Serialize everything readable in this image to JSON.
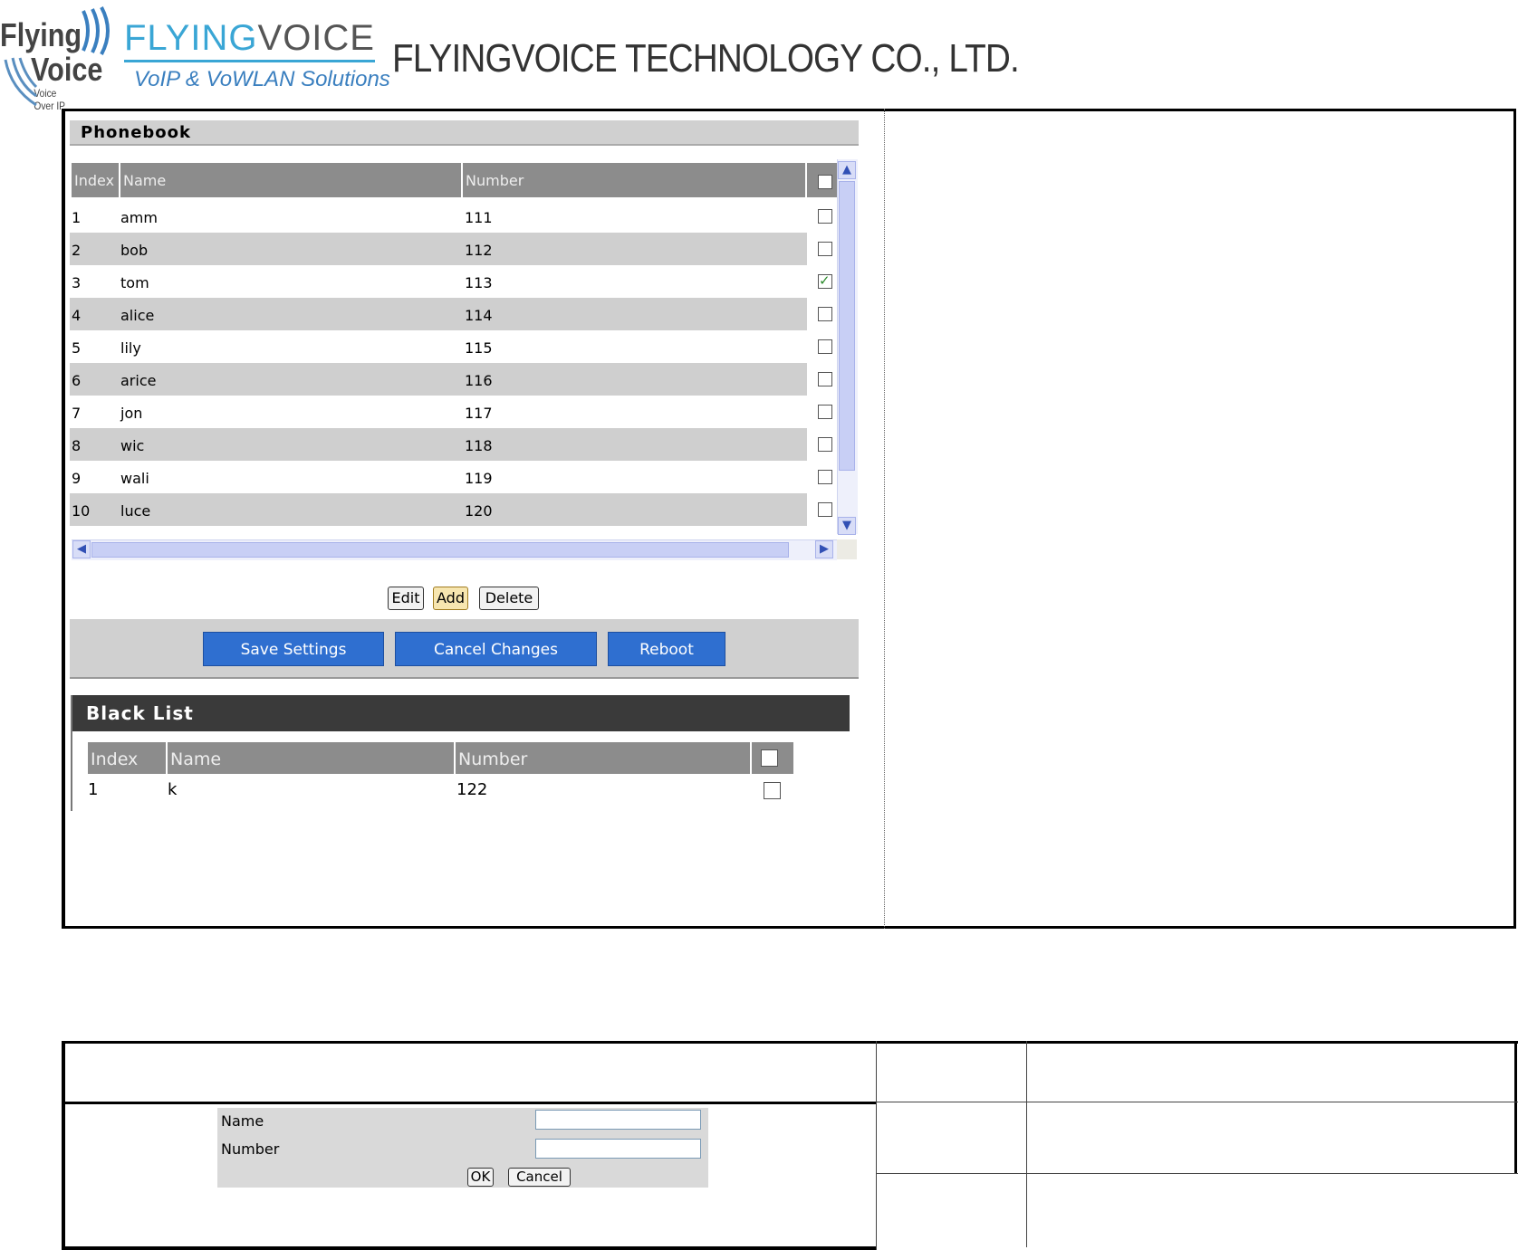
{
  "header": {
    "logo1_line1": "Flying",
    "logo1_line2": "Voice",
    "logo1_tagline": "Voice Over IP",
    "logo2_part1": "FLYING",
    "logo2_part2": "VOICE",
    "logo2_tagline": "VoIP & VoWLAN Solutions",
    "company_name": "FLYINGVOICE TECHNOLOGY CO., LTD."
  },
  "phonebook": {
    "title": "Phonebook",
    "columns": [
      "Index",
      "Name",
      "Number"
    ],
    "rows": [
      {
        "index": "1",
        "name": "amm",
        "number": "111",
        "checked": false
      },
      {
        "index": "2",
        "name": "bob",
        "number": "112",
        "checked": false
      },
      {
        "index": "3",
        "name": "tom",
        "number": "113",
        "checked": true
      },
      {
        "index": "4",
        "name": "alice",
        "number": "114",
        "checked": false
      },
      {
        "index": "5",
        "name": "lily",
        "number": "115",
        "checked": false
      },
      {
        "index": "6",
        "name": "arice",
        "number": "116",
        "checked": false
      },
      {
        "index": "7",
        "name": "jon",
        "number": "117",
        "checked": false
      },
      {
        "index": "8",
        "name": "wic",
        "number": "118",
        "checked": false
      },
      {
        "index": "9",
        "name": "wali",
        "number": "119",
        "checked": false
      },
      {
        "index": "10",
        "name": "luce",
        "number": "120",
        "checked": false
      }
    ],
    "buttons": {
      "edit": "Edit",
      "add": "Add",
      "delete": "Delete"
    }
  },
  "actions": {
    "save": "Save Settings",
    "cancel": "Cancel Changes",
    "reboot": "Reboot"
  },
  "blacklist": {
    "title": "Black List",
    "columns": [
      "Index",
      "Name",
      "Number"
    ],
    "rows": [
      {
        "index": "1",
        "name": "k",
        "number": "122",
        "checked": false
      }
    ]
  },
  "dialog": {
    "name_label": "Name",
    "number_label": "Number",
    "name_value": "",
    "number_value": "",
    "ok": "OK",
    "cancel": "Cancel"
  },
  "colors": {
    "brand_blue": "#3aa6d5",
    "button_blue": "#2f6fd0",
    "header_gray": "#8c8c8c",
    "row_alt_gray": "#cfcfcf"
  }
}
